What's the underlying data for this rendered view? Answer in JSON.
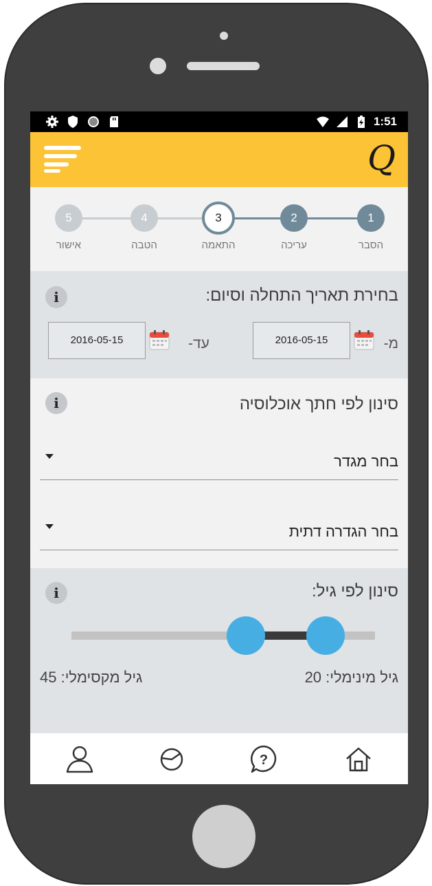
{
  "statusbar": {
    "time": "1:51",
    "left_icons": [
      "gear-icon",
      "shield-icon",
      "circle-icon",
      "sd-card-icon"
    ],
    "right_icons": [
      "wifi-icon",
      "signal-icon",
      "battery-charging-icon"
    ]
  },
  "appbar": {
    "logo": "Q",
    "menu_icon": "menu-icon"
  },
  "stepper": {
    "steps": [
      {
        "number": "1",
        "label": "הסבר",
        "state": "completed"
      },
      {
        "number": "2",
        "label": "עריכה",
        "state": "completed"
      },
      {
        "number": "3",
        "label": "התאמה",
        "state": "current"
      },
      {
        "number": "4",
        "label": "הטבה",
        "state": "upcoming"
      },
      {
        "number": "5",
        "label": "אישור",
        "state": "upcoming"
      }
    ]
  },
  "date_section": {
    "title": "בחירת תאריך התחלה וסיום:",
    "from_label": "מ-",
    "from_value": "2016-05-15",
    "to_label": "עד-",
    "to_value": "2016-05-15"
  },
  "filter_section": {
    "title": "סינון לפי חתך אוכלוסיה",
    "gender_select": "בחר מגדר",
    "religion_select": "בחר הגדרה דתית"
  },
  "age_section": {
    "title": "סינון לפי גיל:",
    "min_label": "גיל מינימלי: 20",
    "max_label": "גיל מקסימלי: 45",
    "min_value": 20,
    "max_value": 45
  },
  "bottom_nav": {
    "items": [
      "home-icon",
      "help-icon",
      "pie-chart-icon",
      "user-icon"
    ]
  },
  "colors": {
    "accent": "#fdc336",
    "step_completed": "#708a9a",
    "step_upcoming": "#c8cdd1",
    "slider_thumb": "#46aee2",
    "section_gray": "#dfe3e6"
  }
}
